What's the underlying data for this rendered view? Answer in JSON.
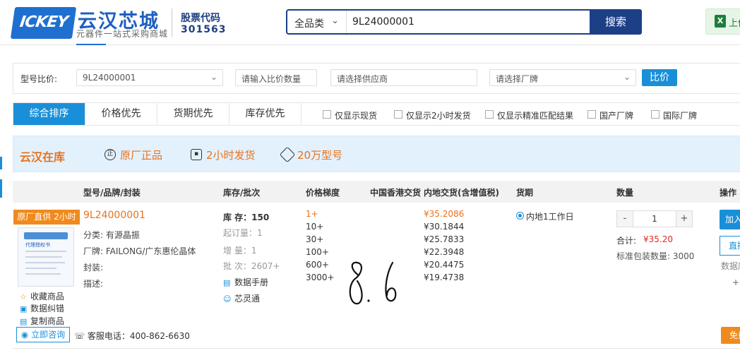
{
  "header": {
    "logo_mark": "ICKEY",
    "brand_name": "云汉芯城",
    "brand_slogan": "元器件一站式采购商城",
    "stock_label": "股票代码",
    "stock_code": "301563",
    "search": {
      "category": "全品类",
      "query": "9L24000001",
      "button": "搜索"
    },
    "excel_label": "上传"
  },
  "compare": {
    "label": "型号比价:",
    "part_select": "9L24000001",
    "qty_placeholder": "请输入比价数量",
    "supplier_placeholder": "请选择供应商",
    "brand_placeholder": "请选择厂牌",
    "button": "比价"
  },
  "tabs": [
    {
      "label": "综合排序",
      "active": true
    },
    {
      "label": "价格优先",
      "active": false
    },
    {
      "label": "货期优先",
      "active": false
    },
    {
      "label": "库存优先",
      "active": false
    }
  ],
  "filters": [
    "仅显示现货",
    "仅显示2小时发货",
    "仅显示精准匹配结果",
    "国产厂牌",
    "国际厂牌"
  ],
  "banner": {
    "title": "云汉在库",
    "features": [
      "原厂正品",
      "2小时发货",
      "20万型号"
    ]
  },
  "table": {
    "headers": [
      "型号/品牌/封装",
      "库存/批次",
      "价格梯度",
      "中国香港交货",
      "内地交货(含增值税)",
      "货期",
      "数量",
      "操作"
    ]
  },
  "product": {
    "badge": "原厂直供 2小时发货",
    "thumb_title": "代理授权书",
    "part_no": "9L24000001",
    "category": "分类:  有源晶振",
    "brand": "厂牌:  FAILONG/广东惠伦晶体",
    "package": "封装:",
    "description": "描述:",
    "side_links": [
      "收藏商品",
      "数据纠错",
      "复制商品"
    ],
    "consult_button": "立即咨询",
    "phone": "客服电话：400-862-6630",
    "stock": "库  存：150",
    "min_order": "起订量：1",
    "increment": "增  量：1",
    "batch": "批  次：2607+",
    "datasheet": "数据手册",
    "xinlingtong": "芯灵通",
    "price_tiers": [
      {
        "qty": "1+",
        "price": "¥35.2086"
      },
      {
        "qty": "10+",
        "price": "¥30.1844"
      },
      {
        "qty": "30+",
        "price": "¥25.7833"
      },
      {
        "qty": "100+",
        "price": "¥22.3948"
      },
      {
        "qty": "600+",
        "price": "¥20.4475"
      },
      {
        "qty": "3000+",
        "price": "¥19.4738"
      }
    ],
    "delivery_option": "内地1工作日",
    "quantity": "1",
    "total_label": "合计:",
    "total_value": "¥35.20",
    "pack_qty": "标准包装数量: 3000",
    "op_add": "加入购物车",
    "op_direct": "直接购买",
    "op_text": "数据库",
    "op_plus": "+",
    "op_free": "免费样品",
    "handwriting": "8.6"
  }
}
